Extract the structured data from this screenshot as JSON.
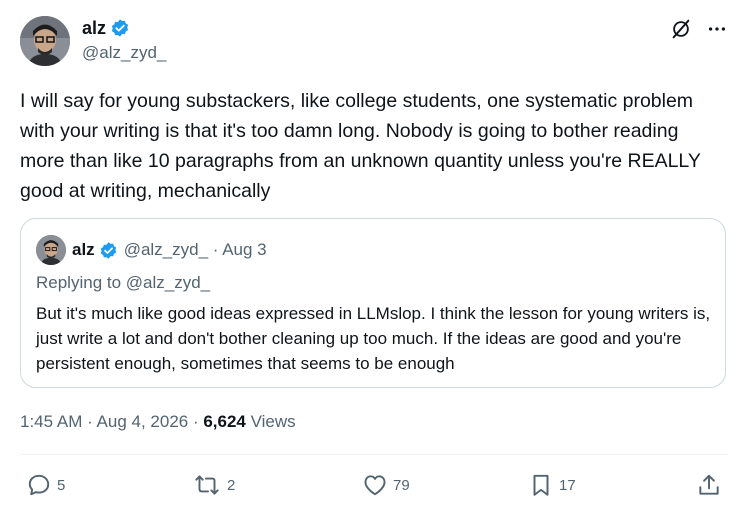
{
  "tweet": {
    "author": {
      "name": "alz",
      "handle": "@alz_zyd_"
    },
    "text": "I will say for young substackers, like college students, one systematic problem with your writing is that it's too damn long. Nobody is going to bother reading more than like 10 paragraphs from an unknown quantity unless you're REALLY good at writing, mechanically",
    "timestamp": "1:45 AM · Aug 4, 2026 · ",
    "views_count": "6,624",
    "views_label": " Views",
    "top_icons": [
      "grok-icon",
      "more-icon"
    ]
  },
  "quote": {
    "name": "alz",
    "meta": "@alz_zyd_ · Aug 3",
    "replying_to": "Replying to @alz_zyd_",
    "text": "But it's much like good ideas expressed in LLMslop. I think the lesson for young writers is, just write a lot and don't bother cleaning up too much. If the ideas are good and you're persistent enough, sometimes that seems to be enough"
  },
  "actions": {
    "replies": "5",
    "reposts": "2",
    "likes": "79",
    "bookmarks": "17"
  },
  "colors": {
    "verified": "#1d9bf0",
    "secondary_text": "#536471",
    "border": "#cfd9de"
  }
}
